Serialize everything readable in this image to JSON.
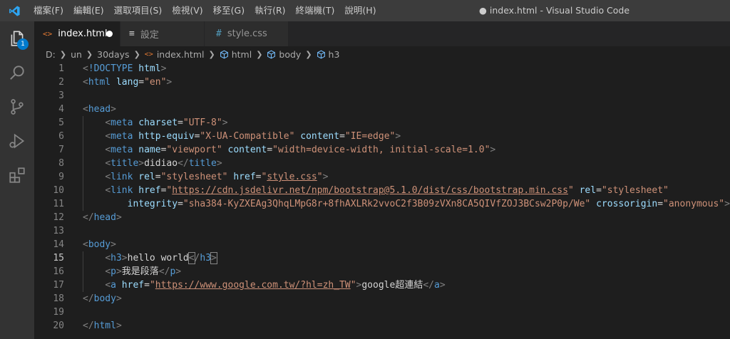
{
  "titlebar": {
    "menu": [
      "檔案(F)",
      "編輯(E)",
      "選取項目(S)",
      "檢視(V)",
      "移至(G)",
      "執行(R)",
      "終端機(T)",
      "說明(H)"
    ],
    "window_title": "● index.html - Visual Studio Code"
  },
  "activitybar": {
    "explorer_badge": "1",
    "icons": [
      "files-icon",
      "search-icon",
      "source-control-icon",
      "run-debug-icon",
      "extensions-icon"
    ]
  },
  "tabs": [
    {
      "icon": "<>",
      "label": "index.html",
      "dirty": true
    },
    {
      "icon": "≡",
      "label": "設定"
    },
    {
      "icon": "#",
      "label": "style.css"
    }
  ],
  "breadcrumb": [
    "D:",
    "un",
    "30days",
    "index.html",
    "html",
    "body",
    "h3"
  ],
  "editor": {
    "current_line": 15,
    "lines": [
      {
        "n": "1",
        "tokens": [
          [
            "br",
            "<"
          ],
          [
            "tag",
            "!DOCTYPE"
          ],
          [
            "txt",
            " "
          ],
          [
            "at",
            "html"
          ],
          [
            "br",
            ">"
          ]
        ]
      },
      {
        "n": "2",
        "tokens": [
          [
            "br",
            "<"
          ],
          [
            "tag",
            "html"
          ],
          [
            "txt",
            " "
          ],
          [
            "at",
            "lang"
          ],
          [
            "txt",
            "="
          ],
          [
            "str",
            "\"en\""
          ],
          [
            "br",
            ">"
          ]
        ]
      },
      {
        "n": "3",
        "tokens": []
      },
      {
        "n": "4",
        "tokens": [
          [
            "br",
            "<"
          ],
          [
            "tag",
            "head"
          ],
          [
            "br",
            ">"
          ]
        ]
      },
      {
        "n": "5",
        "tokens": [
          [
            "txt",
            "    "
          ],
          [
            "br",
            "<"
          ],
          [
            "tag",
            "meta"
          ],
          [
            "txt",
            " "
          ],
          [
            "at",
            "charset"
          ],
          [
            "txt",
            "="
          ],
          [
            "str",
            "\"UTF-8\""
          ],
          [
            "br",
            ">"
          ]
        ]
      },
      {
        "n": "6",
        "tokens": [
          [
            "txt",
            "    "
          ],
          [
            "br",
            "<"
          ],
          [
            "tag",
            "meta"
          ],
          [
            "txt",
            " "
          ],
          [
            "at",
            "http-equiv"
          ],
          [
            "txt",
            "="
          ],
          [
            "str",
            "\"X-UA-Compatible\""
          ],
          [
            "txt",
            " "
          ],
          [
            "at",
            "content"
          ],
          [
            "txt",
            "="
          ],
          [
            "str",
            "\"IE=edge\""
          ],
          [
            "br",
            ">"
          ]
        ]
      },
      {
        "n": "7",
        "tokens": [
          [
            "txt",
            "    "
          ],
          [
            "br",
            "<"
          ],
          [
            "tag",
            "meta"
          ],
          [
            "txt",
            " "
          ],
          [
            "at",
            "name"
          ],
          [
            "txt",
            "="
          ],
          [
            "str",
            "\"viewport\""
          ],
          [
            "txt",
            " "
          ],
          [
            "at",
            "content"
          ],
          [
            "txt",
            "="
          ],
          [
            "str",
            "\"width=device-width, initial-scale=1.0\""
          ],
          [
            "br",
            ">"
          ]
        ]
      },
      {
        "n": "8",
        "tokens": [
          [
            "txt",
            "    "
          ],
          [
            "br",
            "<"
          ],
          [
            "tag",
            "title"
          ],
          [
            "br",
            ">"
          ],
          [
            "txt",
            "didiao"
          ],
          [
            "br",
            "</"
          ],
          [
            "tag",
            "title"
          ],
          [
            "br",
            ">"
          ]
        ]
      },
      {
        "n": "9",
        "tokens": [
          [
            "txt",
            "    "
          ],
          [
            "br",
            "<"
          ],
          [
            "tag",
            "link"
          ],
          [
            "txt",
            " "
          ],
          [
            "at",
            "rel"
          ],
          [
            "txt",
            "="
          ],
          [
            "str",
            "\"stylesheet\""
          ],
          [
            "txt",
            " "
          ],
          [
            "at",
            "href"
          ],
          [
            "txt",
            "="
          ],
          [
            "str",
            "\""
          ],
          [
            "stru",
            "style.css"
          ],
          [
            "str",
            "\""
          ],
          [
            "br",
            ">"
          ]
        ]
      },
      {
        "n": "10",
        "tokens": [
          [
            "txt",
            "    "
          ],
          [
            "br",
            "<"
          ],
          [
            "tag",
            "link"
          ],
          [
            "txt",
            " "
          ],
          [
            "at",
            "href"
          ],
          [
            "txt",
            "="
          ],
          [
            "str",
            "\""
          ],
          [
            "stru",
            "https://cdn.jsdelivr.net/npm/bootstrap@5.1.0/dist/css/bootstrap.min.css"
          ],
          [
            "str",
            "\""
          ],
          [
            "txt",
            " "
          ],
          [
            "at",
            "rel"
          ],
          [
            "txt",
            "="
          ],
          [
            "str",
            "\"stylesheet\""
          ]
        ]
      },
      {
        "n": "11",
        "tokens": [
          [
            "txt",
            "        "
          ],
          [
            "at",
            "integrity"
          ],
          [
            "txt",
            "="
          ],
          [
            "str",
            "\"sha384-KyZXEAg3QhqLMpG8r+8fhAXLRk2vvoC2f3B09zVXn8CA5QIVfZOJ3BCsw2P0p/We\""
          ],
          [
            "txt",
            " "
          ],
          [
            "at",
            "crossorigin"
          ],
          [
            "txt",
            "="
          ],
          [
            "str",
            "\"anonymous\""
          ],
          [
            "br",
            ">"
          ]
        ]
      },
      {
        "n": "12",
        "tokens": [
          [
            "br",
            "</"
          ],
          [
            "tag",
            "head"
          ],
          [
            "br",
            ">"
          ]
        ]
      },
      {
        "n": "13",
        "tokens": []
      },
      {
        "n": "14",
        "tokens": [
          [
            "br",
            "<"
          ],
          [
            "tag",
            "body"
          ],
          [
            "br",
            ">"
          ]
        ]
      },
      {
        "n": "15",
        "tokens": [
          [
            "txt",
            "    "
          ],
          [
            "br",
            "<"
          ],
          [
            "tag",
            "h3"
          ],
          [
            "br",
            ">"
          ],
          [
            "txt",
            "hello world"
          ],
          [
            "brhl",
            "<"
          ],
          [
            "br",
            "/"
          ],
          [
            "tag",
            "h3"
          ],
          [
            "brhl",
            ">"
          ]
        ]
      },
      {
        "n": "16",
        "tokens": [
          [
            "txt",
            "    "
          ],
          [
            "br",
            "<"
          ],
          [
            "tag",
            "p"
          ],
          [
            "br",
            ">"
          ],
          [
            "txt",
            "我是段落"
          ],
          [
            "br",
            "</"
          ],
          [
            "tag",
            "p"
          ],
          [
            "br",
            ">"
          ]
        ]
      },
      {
        "n": "17",
        "tokens": [
          [
            "txt",
            "    "
          ],
          [
            "br",
            "<"
          ],
          [
            "tag",
            "a"
          ],
          [
            "txt",
            " "
          ],
          [
            "at",
            "href"
          ],
          [
            "txt",
            "="
          ],
          [
            "str",
            "\""
          ],
          [
            "stru",
            "https://www.google.com.tw/?hl=zh_TW"
          ],
          [
            "str",
            "\""
          ],
          [
            "br",
            ">"
          ],
          [
            "txt",
            "google超連結"
          ],
          [
            "br",
            "</"
          ],
          [
            "tag",
            "a"
          ],
          [
            "br",
            ">"
          ]
        ]
      },
      {
        "n": "18",
        "tokens": [
          [
            "br",
            "</"
          ],
          [
            "tag",
            "body"
          ],
          [
            "br",
            ">"
          ]
        ]
      },
      {
        "n": "19",
        "tokens": []
      },
      {
        "n": "20",
        "tokens": [
          [
            "br",
            "</"
          ],
          [
            "tag",
            "html"
          ],
          [
            "br",
            ">"
          ]
        ]
      }
    ]
  },
  "colors": {
    "accent": "#007acc",
    "tag": "#569cd6",
    "attribute": "#9cdcfe",
    "string": "#ce9178",
    "text": "#d4d4d4",
    "bracket": "#808080"
  }
}
